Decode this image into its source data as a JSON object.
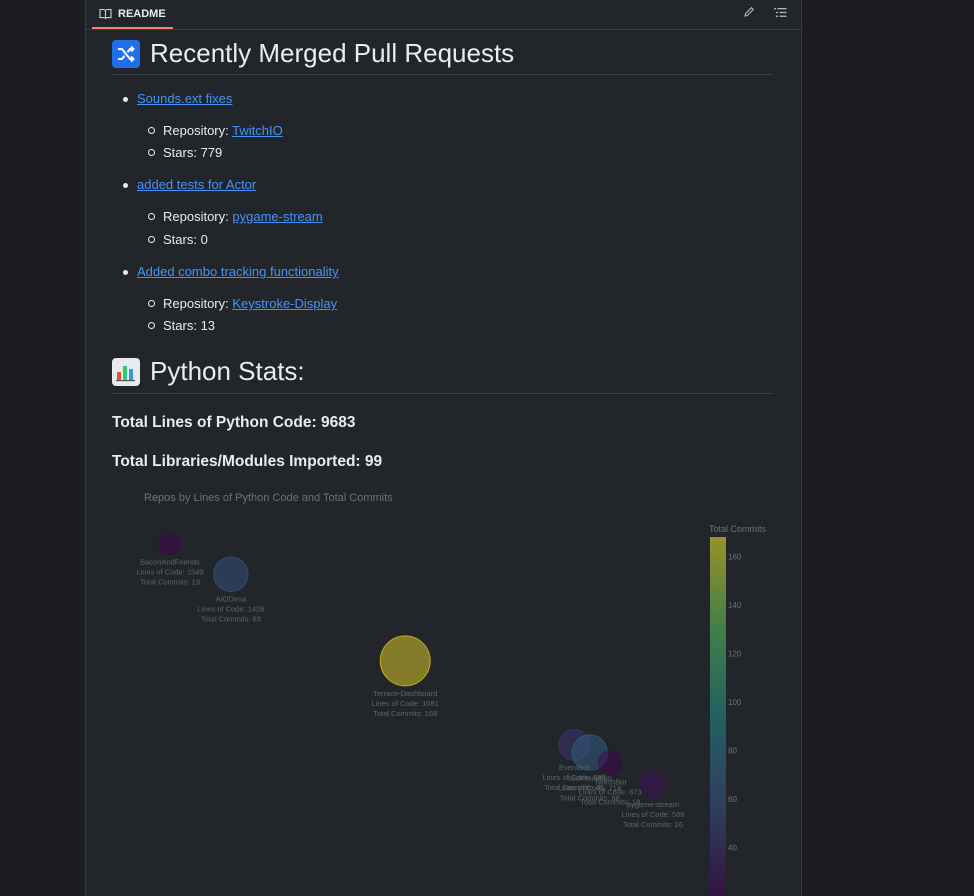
{
  "header": {
    "tab_label": "README"
  },
  "prs": {
    "title": "Recently Merged Pull Requests",
    "items": [
      {
        "title": "Sounds.ext fixes",
        "repo_label": "Repository:",
        "repo": "TwitchIO",
        "stars": "Stars: 779"
      },
      {
        "title": "added tests for Actor",
        "repo_label": "Repository:",
        "repo": "pygame-stream",
        "stars": "Stars: 0"
      },
      {
        "title": "Added combo tracking functionality",
        "repo_label": "Repository:",
        "repo": "Keystroke-Display",
        "stars": "Stars: 13"
      }
    ]
  },
  "stats": {
    "title": "Python Stats:",
    "total_lines": "Total Lines of Python Code: 9683",
    "total_libs": "Total Libraries/Modules Imported: 99"
  },
  "chart_data": {
    "type": "scatter",
    "title": "Repos by Lines of Python Code and Total Commits",
    "colorbar_title": "Total Commits",
    "colorbar_ticks": [
      160,
      140,
      120,
      100,
      80,
      60,
      40
    ],
    "colorbar_range": [
      20,
      168
    ],
    "points": [
      {
        "name": "BaconAndFriends",
        "loc": 1549,
        "commits": 13,
        "loc_label": "Lines of Code: 1549",
        "commits_label": "Total Commits: 13"
      },
      {
        "name": "AIODesa",
        "loc": 1428,
        "commits": 63,
        "loc_label": "Lines of Code: 1428",
        "commits_label": "Total Commits: 63"
      },
      {
        "name": "Terrace-Dashboard",
        "loc": 1081,
        "commits": 168,
        "loc_label": "Lines of Code: 1081",
        "commits_label": "Total Commits: 168"
      },
      {
        "name": "EventBot",
        "loc": 745,
        "commits": 45,
        "loc_label": "Lines of Code: 745",
        "commits_label": "Total Commits: 45"
      },
      {
        "name": "sockheadtips",
        "loc": 714,
        "commits": 68,
        "loc_label": "Lines of Code: 714",
        "commits_label": "Total Commits: 68"
      },
      {
        "name": "TwitchBot",
        "loc": 673,
        "commits": 18,
        "loc_label": "Lines of Code: 673",
        "commits_label": "Total Commits: 18"
      },
      {
        "name": "pygame-stream",
        "loc": 588,
        "commits": 26,
        "loc_label": "Lines of Code: 588",
        "commits_label": "Total Commits: 26"
      }
    ]
  }
}
